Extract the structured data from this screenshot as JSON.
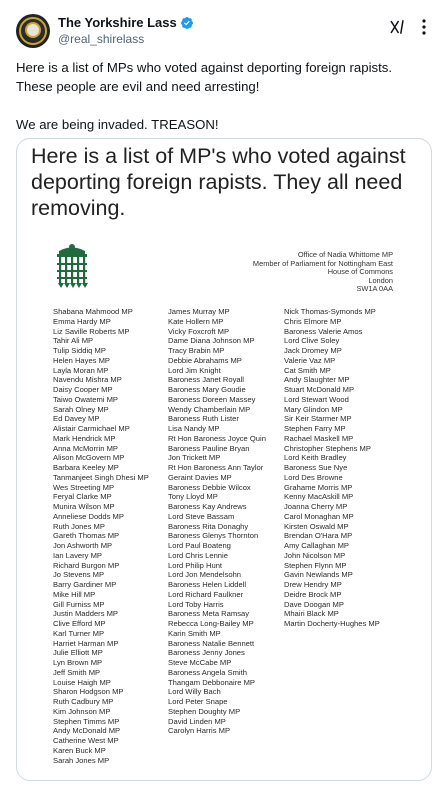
{
  "author": {
    "display_name": "The Yorkshire Lass",
    "handle": "@real_shirelass",
    "verified": true,
    "avatar_icon": "avatar-yorkshire-rose-icon"
  },
  "tweet": {
    "line1": "Here is a list of MPs who voted against deporting foreign rapists. These people are evil and need arresting!",
    "line2": "We are being invaded. TREASON!"
  },
  "image": {
    "title": "Here is a list of MP's who voted against deporting foreign rapists. They all need removing.",
    "office": {
      "line1": "Office of Nadia Whittome MP",
      "line2": "Member of Parliament for Nottingham East",
      "line3": "House of Commons",
      "line4": "London",
      "line5": "SW1A 0AA"
    },
    "column1": [
      "Shabana Mahmood MP",
      "Emma Hardy MP",
      "Liz Saville Roberts MP",
      "Tahir Ali MP",
      "Tulip Siddiq MP",
      "Helen Hayes MP",
      "Layla Moran MP",
      "Navendu Mishra MP",
      "Daisy Cooper MP",
      "Taiwo Owatemi MP",
      "Sarah Olney MP",
      "Ed Davey MP",
      "Alistair Carmichael MP",
      "Mark Hendrick MP",
      "Anna McMorrin MP",
      "Alison McGovern MP",
      "Barbara Keeley MP",
      "Tanmanjeet Singh Dhesi MP",
      "Wes Streeting MP",
      "Feryal Clarke MP",
      "Munira Wilson MP",
      "Anneliese Dodds MP",
      "Ruth Jones MP",
      "Gareth Thomas MP",
      "Jon Ashworth MP",
      "Ian Lavery MP",
      "Richard Burgon MP",
      "Jo Stevens MP",
      "Barry Gardiner MP",
      "Mike Hill MP",
      "Gill Furniss MP",
      "Justin Madders MP",
      "Clive Efford MP",
      "Karl Turner MP",
      "Harriet Harman MP",
      "Julie Elliott MP",
      "Lyn Brown MP",
      "Jeff Smith MP",
      "Louise Haigh MP",
      "Sharon Hodgson MP",
      "Ruth Cadbury MP",
      "Kim Johnson MP",
      "Stephen Timms MP",
      "Andy McDonald MP",
      "Catherine West MP",
      "Karen Buck MP",
      "Sarah Jones MP"
    ],
    "column2": [
      "James Murray MP",
      "Kate Hollern MP",
      "Vicky Foxcroft MP",
      "Dame Diana Johnson MP",
      "Tracy Brabin MP",
      "Debbie Abrahams MP",
      "Lord Jim Knight",
      "Baroness Janet Royall",
      "Baroness Mary Goudie",
      "Baroness Doreen Massey",
      "Wendy Chamberlain MP",
      "Baroness Ruth Lister",
      "Lisa Nandy MP",
      "Rt Hon Baroness Joyce Quin",
      "Baroness Pauline Bryan",
      "Jon Trickett MP",
      "Rt Hon Baroness Ann Taylor",
      "Geraint Davies MP",
      "Baroness Debbie Wilcox",
      "Tony Lloyd MP",
      "Baroness Kay Andrews",
      "Lord Steve Bassam",
      "Baroness Rita Donaghy",
      "Baroness Glenys Thornton",
      "Lord Paul Boateng",
      "Lord Chris Lennie",
      "Lord Philip Hunt",
      "Lord Jon Mendelsohn",
      "Baroness Helen Liddell",
      "Lord Richard Faulkner",
      "Lord Toby Harris",
      "Baroness Meta Ramsay",
      "Rebecca Long-Bailey MP",
      "Karin Smith MP",
      "Baroness Natalie Bennett",
      "Baroness Jenny Jones",
      "Steve McCabe MP",
      "Baroness Angela Smith",
      "Thangam Debbonaire MP",
      "Lord Willy Bach",
      "Lord Peter Snape",
      "Stephen Doughty MP",
      "David Linden MP",
      "Carolyn Harris MP"
    ],
    "column3": [
      "Nick Thomas-Symonds MP",
      "Chris Elmore MP",
      "Baroness Valerie Amos",
      "Lord Clive Soley",
      "Jack Dromey MP",
      "Valerie Vaz MP",
      "Cat Smith MP",
      "Andy Slaughter MP",
      "Stuart McDonald MP",
      "Lord Stewart Wood",
      "Mary Glindon MP",
      "Sir Keir Starmer MP",
      "Stephen Farry MP",
      "Rachael Maskell MP",
      "Christopher Stephens MP",
      "Lord Keith Bradley",
      "Baroness Sue Nye",
      "Lord Des Browne",
      "Grahame Morris MP",
      "Kenny MacAskill MP",
      "Joanna Cherry MP",
      "Carol Monaghan MP",
      "Kirsten Oswald MP",
      "Brendan O'Hara MP",
      "Amy Callaghan MP",
      "John Nicolson MP",
      "Stephen Flynn MP",
      "Gavin Newlands MP",
      "Drew Hendry MP",
      "Deidre Brock MP",
      "Dave Doogan MP",
      "Mhairi Black MP",
      "Martin Docherty-Hughes MP"
    ]
  },
  "colors": {
    "text": "#0f1419",
    "secondary": "#536471",
    "verified": "#1d9bf0",
    "border": "#cfd9de",
    "portcullis": "#1f6b3e"
  }
}
